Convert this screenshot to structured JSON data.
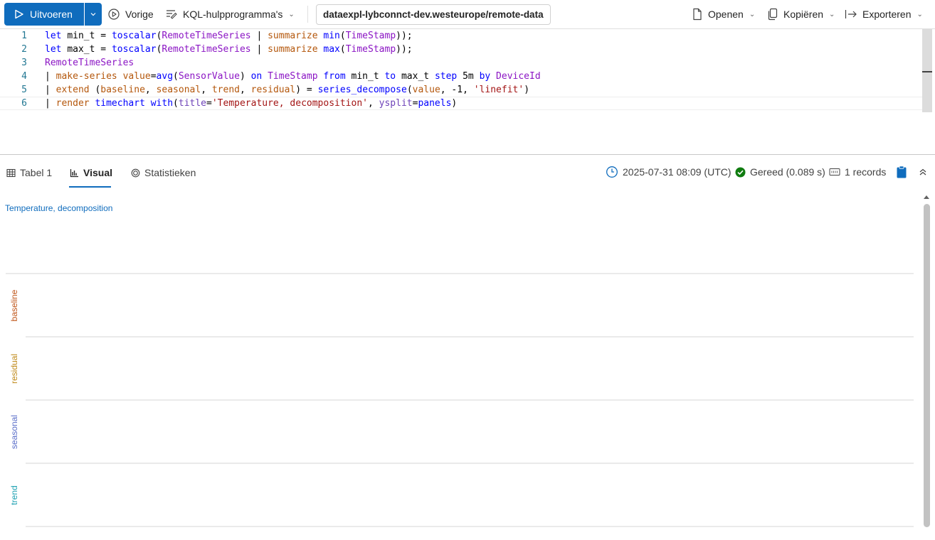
{
  "toolbar": {
    "run_label": "Uitvoeren",
    "previous_label": "Vorige",
    "kql_tools_label": "KQL-hulpprogramma's",
    "cluster_path": "dataexpl-lybconnct-dev.westeurope/remote-data",
    "open_label": "Openen",
    "copy_label": "Kopiëren",
    "export_label": "Exporteren",
    "accent_color": "#0f6cbd"
  },
  "editor": {
    "line_numbers": [
      "1",
      "2",
      "3",
      "4",
      "5",
      "6"
    ],
    "active_line": 6,
    "lines": [
      [
        [
          "kw",
          "let "
        ],
        [
          "pl",
          "min_t = "
        ],
        [
          "fn",
          "toscalar"
        ],
        [
          "pl",
          "("
        ],
        [
          "tbl",
          "RemoteTimeSeries"
        ],
        [
          "pl",
          " | "
        ],
        [
          "op",
          "summarize "
        ],
        [
          "fn",
          "min"
        ],
        [
          "pl",
          "("
        ],
        [
          "tbl",
          "TimeStamp"
        ],
        [
          "pl",
          "));"
        ]
      ],
      [
        [
          "kw",
          "let "
        ],
        [
          "pl",
          "max_t = "
        ],
        [
          "fn",
          "toscalar"
        ],
        [
          "pl",
          "("
        ],
        [
          "tbl",
          "RemoteTimeSeries"
        ],
        [
          "pl",
          " | "
        ],
        [
          "op",
          "summarize "
        ],
        [
          "fn",
          "max"
        ],
        [
          "pl",
          "("
        ],
        [
          "tbl",
          "TimeStamp"
        ],
        [
          "pl",
          "));"
        ]
      ],
      [
        [
          "tbl",
          "RemoteTimeSeries"
        ]
      ],
      [
        [
          "pl",
          "| "
        ],
        [
          "op",
          "make-series "
        ],
        [
          "op",
          "value"
        ],
        [
          "pl",
          "="
        ],
        [
          "fn",
          "avg"
        ],
        [
          "pl",
          "("
        ],
        [
          "tbl",
          "SensorValue"
        ],
        [
          "pl",
          ") "
        ],
        [
          "kw",
          "on "
        ],
        [
          "tbl",
          "TimeStamp "
        ],
        [
          "kw",
          "from "
        ],
        [
          "pl",
          "min_t "
        ],
        [
          "kw",
          "to "
        ],
        [
          "pl",
          "max_t "
        ],
        [
          "kw",
          "step "
        ],
        [
          "pl",
          "5m "
        ],
        [
          "kw",
          "by "
        ],
        [
          "tbl",
          "DeviceId"
        ]
      ],
      [
        [
          "pl",
          "| "
        ],
        [
          "op",
          "extend "
        ],
        [
          "pl",
          "("
        ],
        [
          "op",
          "baseline"
        ],
        [
          "pl",
          ", "
        ],
        [
          "op",
          "seasonal"
        ],
        [
          "pl",
          ", "
        ],
        [
          "op",
          "trend"
        ],
        [
          "pl",
          ", "
        ],
        [
          "op",
          "residual"
        ],
        [
          "pl",
          ") = "
        ],
        [
          "fn",
          "series_decompose"
        ],
        [
          "pl",
          "("
        ],
        [
          "op",
          "value"
        ],
        [
          "pl",
          ", -1, "
        ],
        [
          "str",
          "'linefit'"
        ],
        [
          "pl",
          ")"
        ]
      ],
      [
        [
          "pl",
          "| "
        ],
        [
          "op",
          "render "
        ],
        [
          "kw",
          "timechart "
        ],
        [
          "kw",
          "with"
        ],
        [
          "pl",
          "("
        ],
        [
          "prm",
          "title"
        ],
        [
          "pl",
          "="
        ],
        [
          "str",
          "'Temperature, decomposition'"
        ],
        [
          "pl",
          ", "
        ],
        [
          "prm",
          "ysplit"
        ],
        [
          "pl",
          "="
        ],
        [
          "kw",
          "panels"
        ],
        [
          "pl",
          ")"
        ]
      ]
    ]
  },
  "results": {
    "tabs": [
      {
        "label": "Tabel 1",
        "icon": "table-icon"
      },
      {
        "label": "Visual",
        "icon": "chart-icon"
      },
      {
        "label": "Statistieken",
        "icon": "stats-icon"
      }
    ],
    "selected_tab": "Visual",
    "timestamp": "2025-07-31 08:09 (UTC)",
    "status": "Gereed (0.089 s)",
    "records": "1 records",
    "status_color": "#107c10"
  },
  "chart_data": {
    "type": "line",
    "title": "Temperature, decomposition",
    "panels": [
      {
        "name": "baseline",
        "color": "#c0561a",
        "values": []
      },
      {
        "name": "residual",
        "color": "#c08a1a",
        "values": []
      },
      {
        "name": "seasonal",
        "color": "#5b6fc9",
        "values": []
      },
      {
        "name": "trend",
        "color": "#1a9fb0",
        "values": []
      }
    ],
    "grid": true
  }
}
